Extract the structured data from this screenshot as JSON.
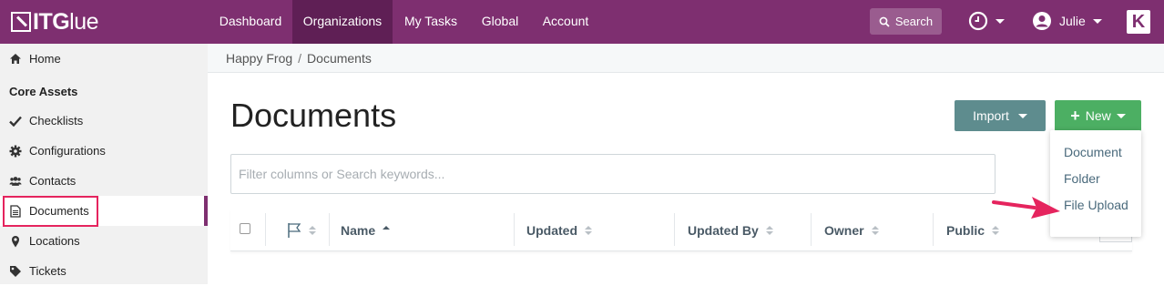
{
  "app": {
    "logo_bold": "ITG",
    "logo_thin": "lue"
  },
  "nav": {
    "items": [
      {
        "label": "Dashboard"
      },
      {
        "label": "Organizations",
        "active": true
      },
      {
        "label": "My Tasks"
      },
      {
        "label": "Global"
      },
      {
        "label": "Account"
      }
    ],
    "search_label": "Search",
    "user_name": "Julie",
    "kaseya_glyph": "K"
  },
  "sidebar": {
    "items": [
      {
        "label": "Home",
        "icon": "home-icon"
      },
      {
        "label": "Checklists",
        "icon": "check-icon"
      },
      {
        "label": "Configurations",
        "icon": "gear-icon"
      },
      {
        "label": "Contacts",
        "icon": "users-icon"
      },
      {
        "label": "Documents",
        "icon": "document-icon",
        "selected": true
      },
      {
        "label": "Locations",
        "icon": "map-pin-icon"
      },
      {
        "label": "Tickets",
        "icon": "tag-icon"
      }
    ],
    "section_heading": "Core Assets"
  },
  "breadcrumb": {
    "org": "Happy Frog",
    "separator": "/",
    "current": "Documents"
  },
  "page": {
    "title": "Documents",
    "import_label": "Import",
    "new_label": "New",
    "filter_placeholder": "Filter columns or Search keywords..."
  },
  "table": {
    "columns": [
      "Name",
      "Updated",
      "Updated By",
      "Owner",
      "Public"
    ]
  },
  "new_menu": {
    "items": [
      "Document",
      "Folder",
      "File Upload"
    ]
  },
  "colors": {
    "brand": "#7e2f70",
    "brand_dark": "#5f1f55",
    "import_button": "#5e8c8e",
    "new_button": "#4caf63",
    "highlight": "#e5245e"
  }
}
